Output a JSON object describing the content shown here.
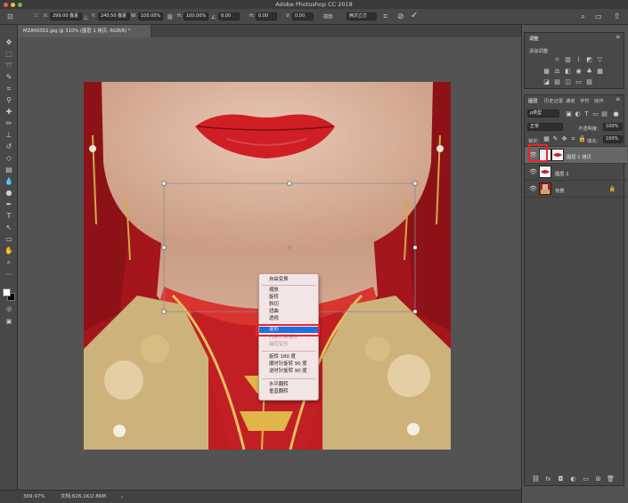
{
  "app": {
    "title": "Adobe Photoshop CC 2018"
  },
  "optbar": {
    "x_label": "X:",
    "x_value": "299.00 像素",
    "y_label": "Y:",
    "y_value": "240.50 像素",
    "w_label": "W:",
    "w_value": "100.00%",
    "h_label": "H:",
    "h_value": "100.00%",
    "angle_value": "0.00",
    "hskew_label": "H:",
    "hskew_value": "0.00",
    "vskew_label": "V:",
    "vskew_value": "0.00",
    "interp_label": "插值:",
    "interp_value": "两次立方"
  },
  "document": {
    "tab_title": "MZA50351.jpg @ 310% (图层 1 拷贝, RGB/8) *"
  },
  "status": {
    "zoom": "309.97%",
    "doc_info": "文档:626.1K/2.86M"
  },
  "panels": {
    "adjust_tab": "调整",
    "adjust_title": "添加调整",
    "layer_tabs": [
      "图层",
      "历史记录",
      "通道",
      "字符",
      "动作"
    ],
    "filter_kind": "ρ类型",
    "blend_mode": "正常",
    "opacity_label": "不透明度:",
    "opacity_value": "100%",
    "lock_label": "锁定:",
    "fill_label": "填充:",
    "fill_value": "100%"
  },
  "layers": [
    {
      "name": "图层 1 拷贝",
      "selected": true,
      "visible": true
    },
    {
      "name": "图层 1",
      "selected": false,
      "visible": true
    },
    {
      "name": "背景",
      "selected": false,
      "visible": true,
      "locked": true
    }
  ],
  "context_menu": {
    "items": [
      {
        "label": "自由变换",
        "state": "normal"
      },
      {
        "label": "缩放",
        "state": "normal"
      },
      {
        "label": "旋转",
        "state": "normal"
      },
      {
        "label": "斜切",
        "state": "normal"
      },
      {
        "label": "扭曲",
        "state": "normal"
      },
      {
        "label": "透视",
        "state": "normal"
      },
      {
        "label": "变形",
        "state": "selected"
      },
      {
        "label": "内容识别缩放",
        "state": "disabled"
      },
      {
        "label": "操控变形",
        "state": "disabled"
      },
      {
        "label": "旋转 180 度",
        "state": "normal"
      },
      {
        "label": "顺时针旋转 90 度",
        "state": "normal"
      },
      {
        "label": "逆时针旋转 90 度",
        "state": "normal"
      },
      {
        "label": "水平翻转",
        "state": "normal"
      },
      {
        "label": "垂直翻转",
        "state": "normal"
      }
    ]
  },
  "colors": {
    "highlight": "#e8262a",
    "menu_selected": "#1f6fe0",
    "lip_red": "#cf1f24",
    "robe_red": "#b81c1d"
  }
}
